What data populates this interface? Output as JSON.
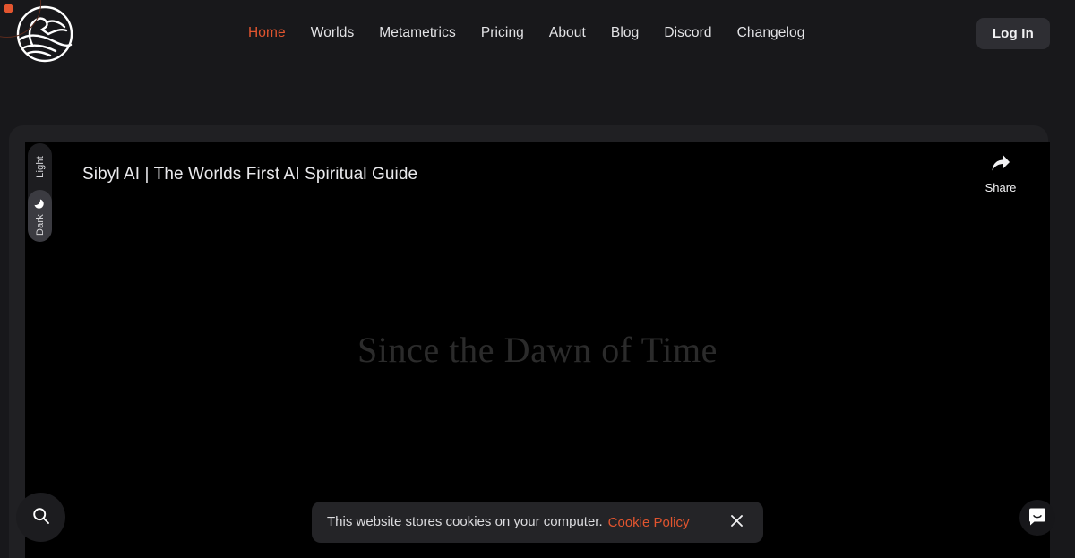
{
  "theme_colors": {
    "accent": "#e2552f",
    "header_bg": "#18181b",
    "container_bg": "#202023",
    "video_bg": "#000000",
    "button_bg": "#2e2e33",
    "banner_bg": "#242427",
    "text_primary": "#e3e3e6"
  },
  "header": {
    "logo_name": "sibyl-globe-logo",
    "nav_items": [
      {
        "label": "Home",
        "active": true
      },
      {
        "label": "Worlds",
        "active": false
      },
      {
        "label": "Metametrics",
        "active": false
      },
      {
        "label": "Pricing",
        "active": false
      },
      {
        "label": "About",
        "active": false
      },
      {
        "label": "Blog",
        "active": false
      },
      {
        "label": "Discord",
        "active": false
      },
      {
        "label": "Changelog",
        "active": false
      }
    ],
    "login_label": "Log In"
  },
  "theme_toggle": {
    "light_label": "Light",
    "dark_label": "Dark",
    "selected": "Dark",
    "icon": "moon-icon"
  },
  "video": {
    "title": "Sibyl AI | The Worlds First AI Spiritual Guide",
    "share_label": "Share",
    "share_icon": "share-arrow-icon",
    "hero_text": "Since the Dawn of Time"
  },
  "search_fab": {
    "icon": "search-icon"
  },
  "chat_launcher": {
    "icon": "chat-bubble-smile-icon"
  },
  "cookie_banner": {
    "message": "This website stores cookies on your computer.",
    "policy_link_label": "Cookie Policy",
    "close_icon": "close-icon"
  }
}
